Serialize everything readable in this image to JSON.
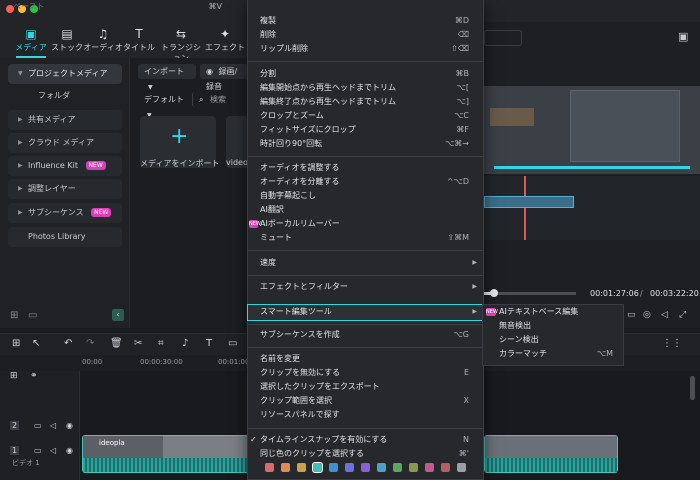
{
  "toolbar": {
    "tabs": [
      {
        "label": "メディア",
        "icon": "media-icon"
      },
      {
        "label": "ストック",
        "icon": "stock-icon"
      },
      {
        "label": "オーディオ",
        "icon": "music-icon"
      },
      {
        "label": "タイトル",
        "icon": "title-icon"
      },
      {
        "label": "トランジション",
        "icon": "transition-icon"
      },
      {
        "label": "エフェクト",
        "icon": "effect-icon"
      }
    ]
  },
  "sidebar": {
    "items": [
      {
        "label": "プロジェクトメディア"
      },
      {
        "label": "フォルダ"
      },
      {
        "label": "共有メディア"
      },
      {
        "label": "クラウド メディア"
      },
      {
        "label": "Influence Kit",
        "badge": "NEW"
      },
      {
        "label": "調整レイヤー"
      },
      {
        "label": "サブシーケンス",
        "badge": "NEW"
      },
      {
        "label": "Photos Library"
      }
    ]
  },
  "media": {
    "import_label": "インポート",
    "record_label": "録画/録音",
    "sort_label": "デフォルト",
    "search_placeholder": "検索",
    "import_tile_label": "メディアをインポート",
    "video_label": "videop"
  },
  "preview": {
    "current_time": "00:01:27:06",
    "separator": "/",
    "total_time": "00:03:22:20"
  },
  "timeline": {
    "ruler": [
      "00:00",
      "00:00:30:00",
      "00:01:00"
    ],
    "track_video2": "2",
    "track_video1": "1",
    "track_video1_label": "ビデオ 1",
    "clip_label": "ideopla"
  },
  "context_menu": {
    "items": [
      {
        "label": "ペースト",
        "shortcut": "⌘V",
        "disabled": true
      },
      {
        "label": "複製",
        "shortcut": "⌘D"
      },
      {
        "label": "削除",
        "shortcut": "⌫"
      },
      {
        "label": "リップル削除",
        "shortcut": "⇧⌫"
      },
      {
        "label": "分割",
        "shortcut": "⌘B"
      },
      {
        "label": "編集開始点から再生ヘッドまでトリム",
        "shortcut": "⌥["
      },
      {
        "label": "編集終了点から再生ヘッドまでトリム",
        "shortcut": "⌥]"
      },
      {
        "label": "クロップとズーム",
        "shortcut": "⌥C"
      },
      {
        "label": "フィットサイズにクロップ",
        "shortcut": "⌘F"
      },
      {
        "label": "時計回り90°回転",
        "shortcut": "⌥⌘→"
      },
      {
        "label": "オーディオを調整する",
        "shortcut": ""
      },
      {
        "label": "オーディオを分離する",
        "shortcut": "^⌥D"
      },
      {
        "label": "自動字幕起こし",
        "shortcut": ""
      },
      {
        "label": "AI翻訳",
        "shortcut": ""
      },
      {
        "label": "AIボーカルリムーバー",
        "shortcut": "",
        "badge": "NEW"
      },
      {
        "label": "ミュート",
        "shortcut": "⇧⌘M"
      },
      {
        "label": "速度",
        "shortcut": ""
      },
      {
        "label": "エフェクトとフィルター",
        "shortcut": ""
      },
      {
        "label": "スマート編集ツール",
        "shortcut": ""
      },
      {
        "label": "サブシーケンスを作成",
        "shortcut": "⌥G"
      },
      {
        "label": "名前を変更",
        "shortcut": ""
      },
      {
        "label": "クリップを無効にする",
        "shortcut": "E"
      },
      {
        "label": "選択したクリップをエクスポート",
        "shortcut": ""
      },
      {
        "label": "クリップ範囲を選択",
        "shortcut": "X"
      },
      {
        "label": "リソースパネルで探す",
        "shortcut": ""
      },
      {
        "label": "タイムラインスナップを有効にする",
        "shortcut": "N",
        "checked": true
      },
      {
        "label": "同じ色のクリップを選択する",
        "shortcut": "⌘'"
      }
    ],
    "colors": [
      "#d96b6b",
      "#e08a55",
      "#c9a24a",
      "#3fbfb3",
      "#3f8fd6",
      "#6f6fe0",
      "#8a5fd6",
      "#4fa0c8",
      "#58a860",
      "#8a9a4a",
      "#c05a8a",
      "#b06060",
      "#9aa0a8"
    ]
  },
  "submenu": {
    "items": [
      {
        "label": "AIテキストベース編集",
        "shortcut": "",
        "badge": "NEW"
      },
      {
        "label": "無音検出",
        "shortcut": ""
      },
      {
        "label": "シーン検出",
        "shortcut": ""
      },
      {
        "label": "カラーマッチ",
        "shortcut": "⌥M"
      }
    ]
  }
}
